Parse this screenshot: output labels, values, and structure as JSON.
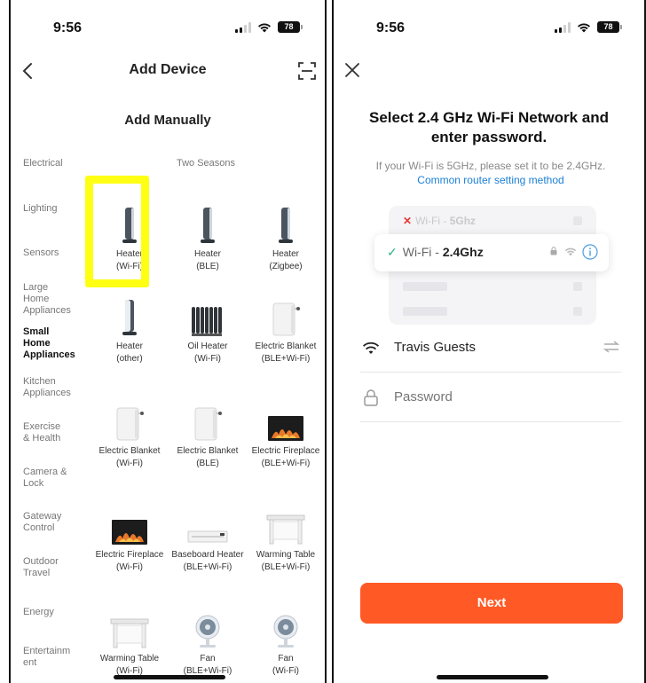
{
  "left_screen": {
    "status": {
      "time": "9:56",
      "battery": "78"
    },
    "nav": {
      "title": "Add Device"
    },
    "section_title": "Add Manually",
    "subcategory_title": "Two Seasons",
    "categories": [
      "Electrical",
      "Lighting",
      "Sensors",
      "Large Home Appliances",
      "Small Home Appliances",
      "Kitchen Appliances",
      "Exercise & Health",
      "Camera & Lock",
      "Gateway Control",
      "Outdoor Travel",
      "Energy",
      "Entertainm ent"
    ],
    "active_category": "Small Home Appliances",
    "devices": [
      {
        "name": "Heater",
        "sub": "(Wi-Fi)",
        "icon": "tower-heater-icon",
        "highlighted": true
      },
      {
        "name": "Heater",
        "sub": "(BLE)",
        "icon": "tower-heater-icon"
      },
      {
        "name": "Heater",
        "sub": "(Zigbee)",
        "icon": "tower-heater-icon"
      },
      {
        "name": "Heater",
        "sub": "(other)",
        "icon": "tower-heater-white-icon"
      },
      {
        "name": "Oil Heater",
        "sub": "(Wi-Fi)",
        "icon": "oil-heater-icon"
      },
      {
        "name": "Electric Blanket",
        "sub": "(BLE+Wi-Fi)",
        "icon": "electric-blanket-icon"
      },
      {
        "name": "Electric Blanket",
        "sub": "(Wi-Fi)",
        "icon": "electric-blanket-icon"
      },
      {
        "name": "Electric Blanket",
        "sub": "(BLE)",
        "icon": "electric-blanket-icon"
      },
      {
        "name": "Electric Fireplace",
        "sub": "(BLE+Wi-Fi)",
        "icon": "fireplace-icon"
      },
      {
        "name": "Electric Fireplace",
        "sub": "(Wi-Fi)",
        "icon": "fireplace-icon"
      },
      {
        "name": "Baseboard Heater",
        "sub": "(BLE+Wi-Fi)",
        "icon": "baseboard-heater-icon"
      },
      {
        "name": "Warming Table",
        "sub": "(BLE+Wi-Fi)",
        "icon": "warming-table-icon"
      },
      {
        "name": "Warming Table",
        "sub": "(Wi-Fi)",
        "icon": "warming-table-icon"
      },
      {
        "name": "Fan",
        "sub": "(BLE+Wi-Fi)",
        "icon": "fan-icon"
      },
      {
        "name": "Fan",
        "sub": "(Wi-Fi)",
        "icon": "fan-icon"
      }
    ]
  },
  "right_screen": {
    "status": {
      "time": "9:56",
      "battery": "78"
    },
    "title": "Select 2.4 GHz Wi-Fi Network and enter password.",
    "subtitle": "If your Wi-Fi is 5GHz, please set it to be 2.4GHz.",
    "link": "Common router setting method",
    "illustration": {
      "bad_prefix": "Wi-Fi - ",
      "bad_band": "5Ghz",
      "good_prefix": "Wi-Fi - ",
      "good_band": "2.4Ghz"
    },
    "network_name": "Travis Guests",
    "password_placeholder": "Password",
    "next_label": "Next"
  },
  "colors": {
    "highlight": "#ffff14",
    "accent": "#ff5a26",
    "link": "#1b7fd6",
    "check": "#30b080",
    "error": "#e53935"
  }
}
